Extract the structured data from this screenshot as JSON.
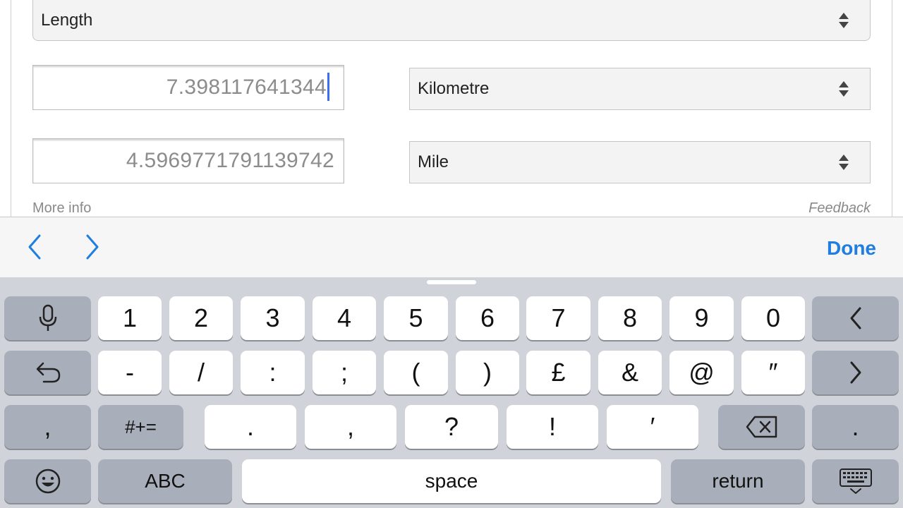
{
  "converter": {
    "category": "Length",
    "from_value": "7.398117641344",
    "from_unit": "Kilometre",
    "to_value": "4.5969771791139742",
    "to_unit": "Mile",
    "more_info": "More info",
    "feedback": "Feedback"
  },
  "accessory": {
    "done_label": "Done"
  },
  "keyboard": {
    "row1": [
      "1",
      "2",
      "3",
      "4",
      "5",
      "6",
      "7",
      "8",
      "9",
      "0"
    ],
    "row2": [
      "-",
      "/",
      ":",
      ";",
      "(",
      ")",
      "£",
      "&",
      "@",
      "″"
    ],
    "row3_left": ",",
    "row3_symbols": "#+=",
    "row3": [
      ".",
      ",",
      "?",
      "!",
      "′"
    ],
    "row3_right": ".",
    "abc_label": "ABC",
    "space_label": "space",
    "return_label": "return"
  },
  "colors": {
    "accent": "#1f7ee0",
    "caret": "#3a6df0",
    "keyboard_bg": "#d0d3d9",
    "key_dark": "#a9afba"
  }
}
